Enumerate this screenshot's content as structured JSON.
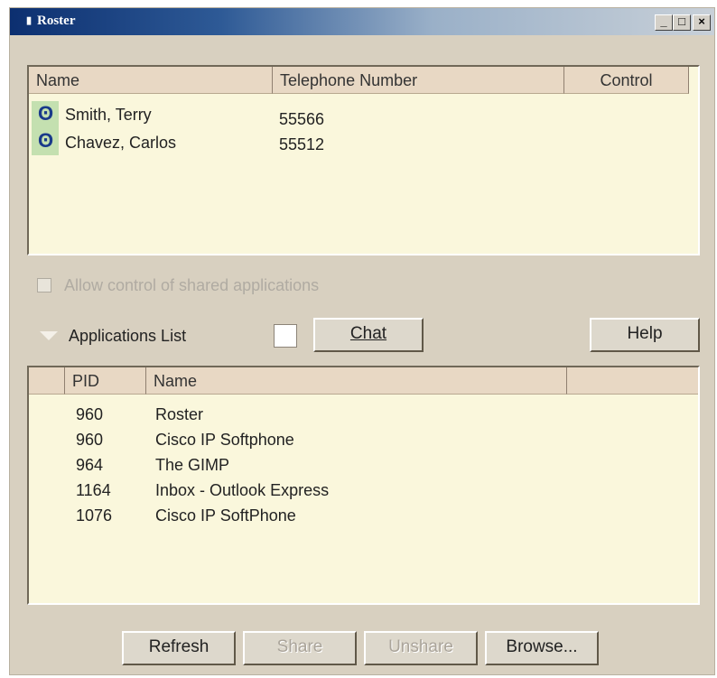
{
  "window": {
    "title": "Roster",
    "title_icon": "▮"
  },
  "titlebar_buttons": {
    "minimize": "_",
    "maximize": "□",
    "close": "×"
  },
  "roster": {
    "columns": [
      "Name",
      "Telephone Number",
      "Control"
    ],
    "rows": [
      {
        "name": "Smith, Terry",
        "phone": "55566",
        "icon": "headset-icon"
      },
      {
        "name": "Chavez, Carlos",
        "phone": "55512",
        "icon": "headset-icon"
      }
    ]
  },
  "allow_control": {
    "label": "Allow control of shared applications",
    "checked": false,
    "enabled": false
  },
  "applications_list_label": "Applications List",
  "chat_button": "Chat",
  "help_button": "Help",
  "apps": {
    "columns": [
      "PID",
      "Name"
    ],
    "rows": [
      {
        "pid": "960",
        "name": "Roster"
      },
      {
        "pid": "960",
        "name": "Cisco IP Softphone"
      },
      {
        "pid": "964",
        "name": "The GIMP"
      },
      {
        "pid": "1164",
        "name": "Inbox - Outlook Express"
      },
      {
        "pid": "1076",
        "name": "Cisco IP SoftPhone"
      }
    ]
  },
  "bottom_buttons": {
    "refresh": "Refresh",
    "share": "Share",
    "unshare": "Unshare",
    "browse": "Browse..."
  }
}
